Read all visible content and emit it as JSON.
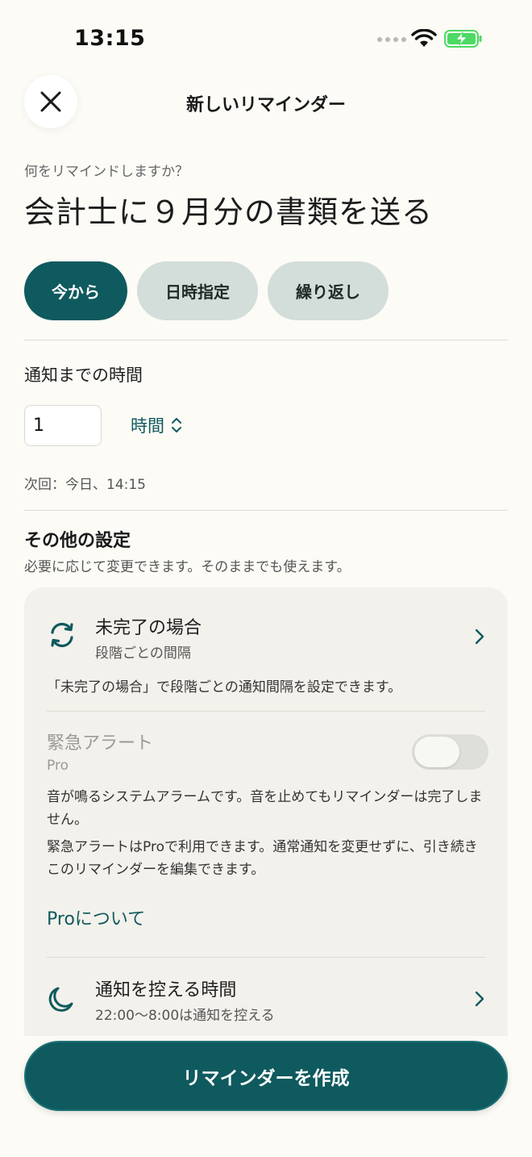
{
  "status_bar": {
    "time": "13:15",
    "icons": [
      "cellular-dots-icon",
      "wifi-icon",
      "battery-charging-icon"
    ],
    "battery_color": "#4cd964"
  },
  "header": {
    "close_icon": "close-icon",
    "title": "新しいリマインダー"
  },
  "reminder": {
    "question": "何をリマインドしますか？",
    "text": "会計士に９月分の書類を送る"
  },
  "tabs": [
    {
      "label": "今から",
      "active": true
    },
    {
      "label": "日時指定",
      "active": false
    },
    {
      "label": "繰り返し",
      "active": false
    }
  ],
  "timer": {
    "label": "通知までの時間",
    "amount": "1",
    "unit": "時間",
    "next": "次回：今日、14:15"
  },
  "other_settings": {
    "title": "その他の設定",
    "subtitle": "必要に応じて変更できます。そのままでも使えます。",
    "incomplete": {
      "icon": "refresh-cycle-icon",
      "title": "未完了の場合",
      "subtitle": "段階ごとの間隔",
      "description": "「未完了の場合」で段階ごとの通知間隔を設定できます。"
    },
    "emergency": {
      "title": "緊急アラート",
      "badge": "Pro",
      "toggle_on": false,
      "description1": "音が鳴るシステムアラームです。音を止めてもリマインダーは完了しません。",
      "description2": "緊急アラートはProで利用できます。通常通知を変更せずに、引き続きこのリマインダーを編集できます。",
      "pro_link": "Proについて"
    },
    "quiet_hours": {
      "icon": "moon-icon",
      "title": "通知を控える時間",
      "subtitle": "22:00〜8:00は通知を控える"
    }
  },
  "create_button": "リマインダーを作成",
  "colors": {
    "accent": "#0f5a5e",
    "inactive_tab": "#d3ddd9",
    "background": "#fcfbf6",
    "card": "#f3f1ec"
  }
}
